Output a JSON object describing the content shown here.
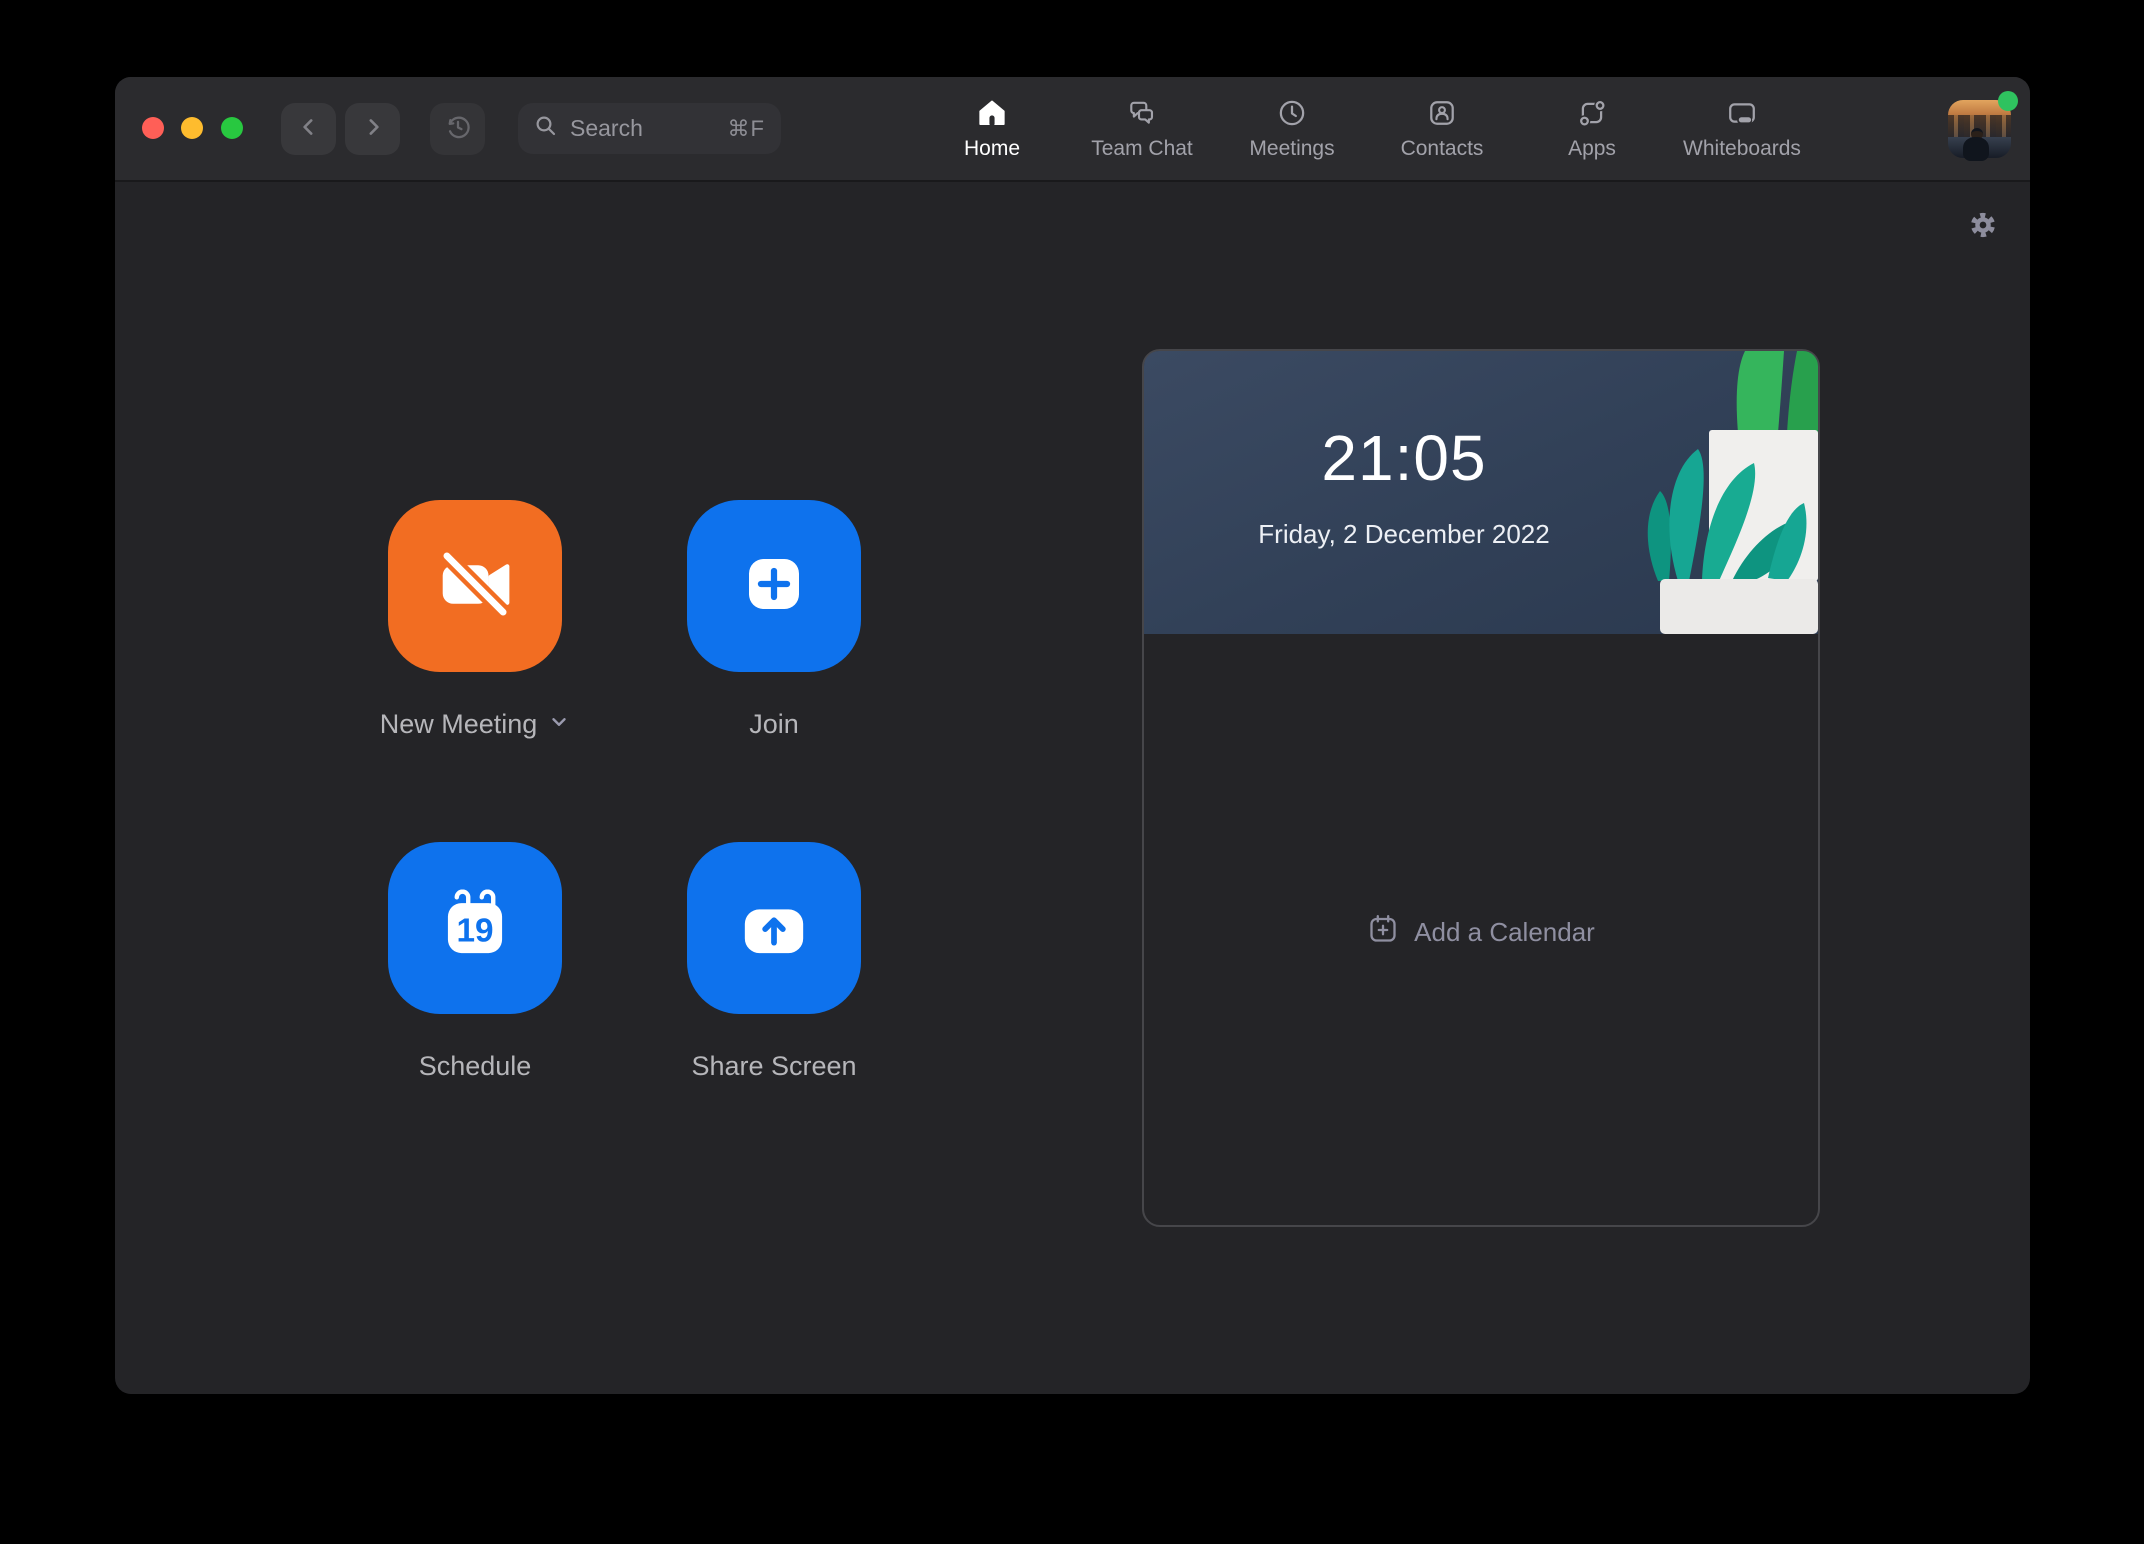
{
  "titlebar": {
    "search": {
      "placeholder": "Search",
      "shortcut": "⌘F"
    },
    "tabs": [
      {
        "label": "Home",
        "active": true
      },
      {
        "label": "Team Chat",
        "active": false
      },
      {
        "label": "Meetings",
        "active": false
      },
      {
        "label": "Contacts",
        "active": false
      },
      {
        "label": "Apps",
        "active": false
      },
      {
        "label": "Whiteboards",
        "active": false
      }
    ]
  },
  "actions": {
    "new_meeting": {
      "label": "New Meeting"
    },
    "join": {
      "label": "Join"
    },
    "schedule": {
      "label": "Schedule",
      "calendar_day": "19"
    },
    "share_screen": {
      "label": "Share Screen"
    }
  },
  "panel": {
    "time": "21:05",
    "date": "Friday, 2 December 2022",
    "add_calendar_label": "Add a Calendar"
  },
  "colors": {
    "accent_blue": "#0e72ed",
    "accent_orange": "#f26d22",
    "traffic_red": "#ff5f57",
    "traffic_yellow": "#febc2e",
    "traffic_green": "#28c840",
    "status_green": "#2fc25f",
    "header_panel_blue": "#33425a"
  }
}
